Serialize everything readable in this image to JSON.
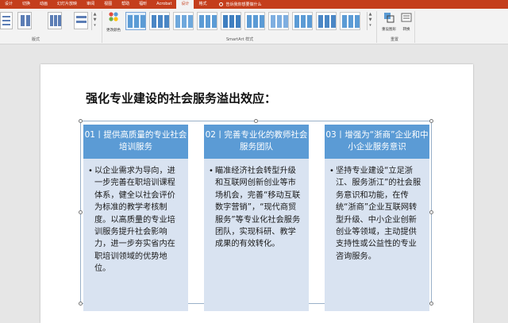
{
  "ribbon": {
    "tabs": [
      "设计",
      "切换",
      "动画",
      "幻灯片放映",
      "审阅",
      "视图",
      "帮助",
      "福昕",
      "Acrobat",
      "设计",
      "格式"
    ],
    "active_tab_index": 9,
    "tell_me": "告诉我你想要做什么",
    "groups": {
      "layouts": "版式",
      "smartart_styles": "SmartArt 样式",
      "reset": "重置"
    },
    "buttons": {
      "change_colors": "更改颜色",
      "reset_graphic": "重设图形",
      "convert": "转换"
    },
    "accent_color": "#c43e1c"
  },
  "slide": {
    "title": "强化专业建设的社会服务溢出效应：",
    "columns": [
      {
        "header": "01丨提供高质量的专业社会培训服务",
        "body": "以企业需求为导向，进一步完善在职培训课程体系，健全以社会评价为标准的教学考核制度。以高质量的专业培训服务提升社会影响力，进一步夯实省内在职培训领域的优势地位。"
      },
      {
        "header": "02丨完善专业化的教师社会服务团队",
        "body": "瞄准经济社会转型升级和互联网创新创业等市场机会，完善“移动互联数字营销”，“现代商贸服务”等专业化社会服务团队，实现科研、教学成果的有效转化。"
      },
      {
        "header": "03丨增强为“浙商”企业和中小企业服务意识",
        "body": "坚持专业建设“立足浙江、服务浙江”的社会服务意识和功能，在传统“浙商”企业互联网转型升级、中小企业创新创业等领域，主动提供支持性或公益性的专业咨询服务。"
      }
    ],
    "header_color": "#5b9bd5",
    "body_color": "#d9e3f1"
  }
}
